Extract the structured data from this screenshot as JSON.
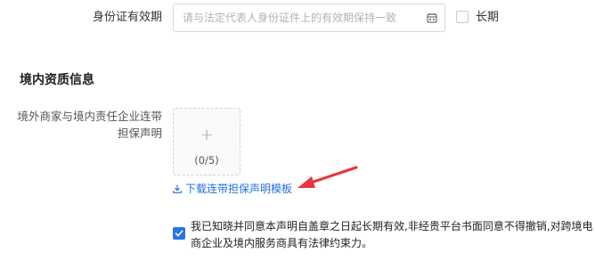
{
  "validity": {
    "label": "身份证有效期",
    "placeholder": "请与法定代表人身份证件上的有效期保持一致",
    "value": "",
    "long_term_label": "长期",
    "long_term_checked": false
  },
  "section": {
    "title": "境内资质信息"
  },
  "guarantee": {
    "label": "境外商家与境内责任企业连带担保声明",
    "upload_count": "(0/5)",
    "template_link": "下载连带担保声明模板"
  },
  "agreement": {
    "checked": true,
    "text": "我已知晓并同意本声明自盖章之日起长期有效,非经贵平台书面同意不得撤销,对跨境电商企业及境内服务商具有法律约束力。"
  },
  "colors": {
    "accent": "#1f6fe0",
    "checkbox_checked": "#2b74e8",
    "annotation_arrow": "#e8363d"
  },
  "icons": [
    "calendar-icon",
    "plus-icon",
    "download-icon",
    "checkmark-icon",
    "annotation-arrow"
  ]
}
